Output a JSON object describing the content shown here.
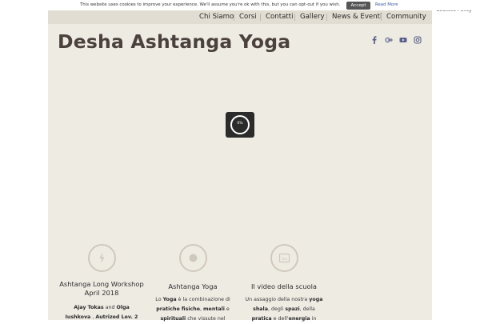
{
  "cookie_bar": {
    "message": "This website uses cookies to improve your experience. We'll assume you're ok with this, but you can opt-out if you wish.",
    "accept_label": "Accept",
    "read_more_label": "Read More",
    "privacy_label": "Privacy & Cookies Policy"
  },
  "nav": {
    "items": [
      "Chi Siamo",
      "Corsi",
      "Contatti",
      "Gallery",
      "News & Eventi",
      "Community"
    ]
  },
  "site": {
    "title": "Desha Ashtanga Yoga"
  },
  "social": {
    "icons": [
      "facebook-icon",
      "google-plus-icon",
      "youtube-icon",
      "instagram-icon"
    ],
    "color": "#5a5f8a"
  },
  "preloader": {
    "percent_label": "0%"
  },
  "features": [
    {
      "icon": "lightning-icon",
      "title_line1": "Ashtanga Long Workshop",
      "title_line2": "April 2018",
      "text_line1_parts": [
        "Ajay Tokas",
        " and ",
        "Olga"
      ],
      "text_line2_parts": [
        "Iushkova",
        " , ",
        "Autrized Lev. 2"
      ]
    },
    {
      "icon": "circle-icon",
      "title": "Ashtanga Yoga",
      "text_line1_parts": [
        "Lo ",
        "Yoga",
        " è la combinazione di"
      ],
      "text_line2_parts": [
        "pratiche fisiche",
        ", ",
        "mentali",
        " e"
      ],
      "text_line3_parts": [
        "spirituali",
        " che vissute nel"
      ]
    },
    {
      "icon": "youtube-icon",
      "title": "Il video della scuola",
      "text_line1_parts": [
        "Un assaggio della nostra ",
        "yoga"
      ],
      "text_line2_parts": [
        "shala",
        ", degli ",
        "spazi",
        ", della"
      ],
      "text_line3_parts": [
        "pratica",
        " e dell'",
        "energia",
        " in"
      ]
    }
  ],
  "colors": {
    "page_bg": "#eeebe3",
    "navbar_bg": "#e2ddd3",
    "title": "#4a403c",
    "preloader_bg": "#2b2b2b",
    "icon_ring": "#cfc8bd"
  }
}
